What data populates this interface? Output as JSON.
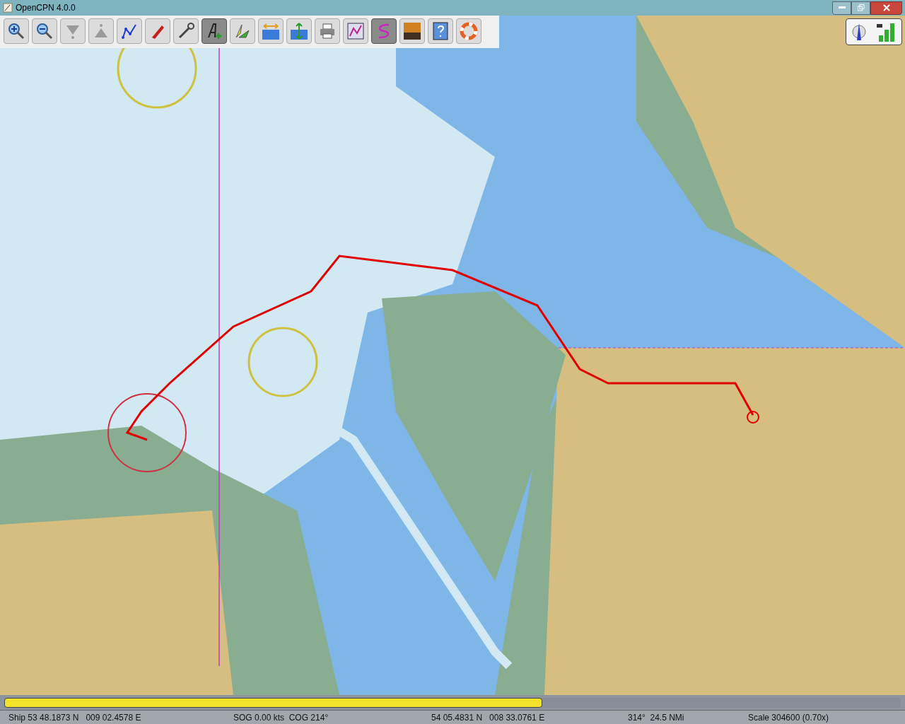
{
  "window": {
    "title": "OpenCPN 4.0.0"
  },
  "toolbar": [
    {
      "kind": "zoom-in",
      "selected": false
    },
    {
      "kind": "zoom-out",
      "selected": false
    },
    {
      "kind": "scale-down",
      "selected": false
    },
    {
      "kind": "scale-up",
      "selected": false
    },
    {
      "kind": "route",
      "selected": false
    },
    {
      "kind": "ship",
      "selected": false
    },
    {
      "kind": "settings",
      "selected": false
    },
    {
      "kind": "text",
      "selected": true
    },
    {
      "kind": "ais",
      "selected": false
    },
    {
      "kind": "current",
      "selected": false
    },
    {
      "kind": "tide",
      "selected": false
    },
    {
      "kind": "print",
      "selected": false
    },
    {
      "kind": "route-manager",
      "selected": false
    },
    {
      "kind": "track",
      "selected": true
    },
    {
      "kind": "color-scheme",
      "selected": false
    },
    {
      "kind": "help",
      "selected": false
    },
    {
      "kind": "mob",
      "selected": false
    }
  ],
  "progress": {
    "level": 0.6
  },
  "status_bar": [
    "Ship 53 48.1873 N   009 02.4578 E",
    "SOG 0.00 kts  COG 214°",
    "54 05.4831 N   008 33.0761 E",
    "314°  24.5 NMi",
    "Scale 304600 (0.70x)"
  ]
}
